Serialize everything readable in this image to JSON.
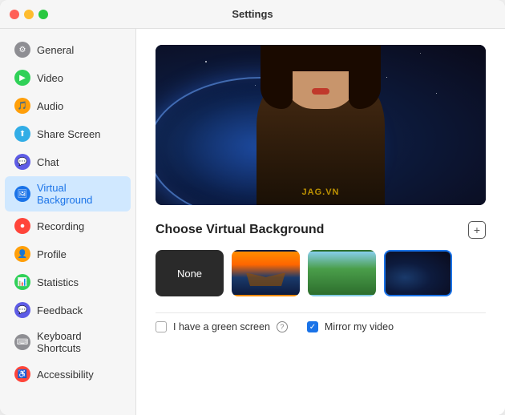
{
  "window": {
    "title": "Settings"
  },
  "sidebar": {
    "items": [
      {
        "id": "general",
        "label": "General",
        "icon": "⚙",
        "iconClass": "icon-general",
        "active": false
      },
      {
        "id": "video",
        "label": "Video",
        "icon": "▶",
        "iconClass": "icon-video",
        "active": false
      },
      {
        "id": "audio",
        "label": "Audio",
        "icon": "🎵",
        "iconClass": "icon-audio",
        "active": false
      },
      {
        "id": "share-screen",
        "label": "Share Screen",
        "icon": "⬆",
        "iconClass": "icon-share",
        "active": false
      },
      {
        "id": "chat",
        "label": "Chat",
        "icon": "💬",
        "iconClass": "icon-chat",
        "active": false
      },
      {
        "id": "virtual-background",
        "label": "Virtual Background",
        "icon": "🖼",
        "iconClass": "icon-vbg",
        "active": true
      },
      {
        "id": "recording",
        "label": "Recording",
        "icon": "⏺",
        "iconClass": "icon-recording",
        "active": false
      },
      {
        "id": "profile",
        "label": "Profile",
        "icon": "👤",
        "iconClass": "icon-profile",
        "active": false
      },
      {
        "id": "statistics",
        "label": "Statistics",
        "icon": "📊",
        "iconClass": "icon-statistics",
        "active": false
      },
      {
        "id": "feedback",
        "label": "Feedback",
        "icon": "💬",
        "iconClass": "icon-feedback",
        "active": false
      },
      {
        "id": "keyboard-shortcuts",
        "label": "Keyboard Shortcuts",
        "icon": "⌨",
        "iconClass": "icon-keyboard",
        "active": false
      },
      {
        "id": "accessibility",
        "label": "Accessibility",
        "icon": "♿",
        "iconClass": "icon-accessibility",
        "active": false
      }
    ]
  },
  "main": {
    "section_title": "Choose Virtual Background",
    "add_button_label": "+",
    "backgrounds": [
      {
        "id": "none",
        "label": "None",
        "type": "none"
      },
      {
        "id": "bridge",
        "label": "Golden Gate Bridge",
        "type": "bridge"
      },
      {
        "id": "green",
        "label": "Green Field",
        "type": "green"
      },
      {
        "id": "space",
        "label": "Space",
        "type": "space"
      }
    ],
    "options": [
      {
        "id": "green-screen",
        "label": "I have a green screen",
        "checked": false,
        "hasHelp": true
      },
      {
        "id": "mirror-video",
        "label": "Mirror my video",
        "checked": true,
        "hasHelp": false
      }
    ]
  }
}
